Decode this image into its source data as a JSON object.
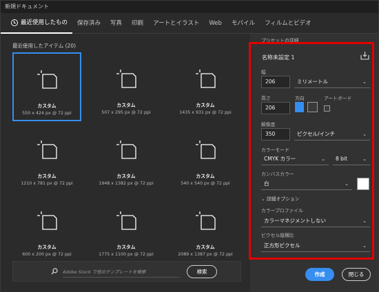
{
  "window": {
    "title": "新規ドキュメント"
  },
  "tabs": [
    {
      "label": "最近使用したもの"
    },
    {
      "label": "保存済み"
    },
    {
      "label": "写真"
    },
    {
      "label": "印刷"
    },
    {
      "label": "アートとイラスト"
    },
    {
      "label": "Web"
    },
    {
      "label": "モバイル"
    },
    {
      "label": "フィルムとビデオ"
    }
  ],
  "recent": {
    "title": "最近使用したアイテム (20)",
    "items": [
      {
        "name": "カスタム",
        "size": "550 x 424 px @ 72 ppi"
      },
      {
        "name": "カスタム",
        "size": "507 x 295 px @ 72 ppi"
      },
      {
        "name": "カスタム",
        "size": "1435 x 931 px @ 72 ppi"
      },
      {
        "name": "カスタム",
        "size": "1210 x 781 px @ 72 ppi"
      },
      {
        "name": "カスタム",
        "size": "1948 x 1382 px @ 72 ppi"
      },
      {
        "name": "カスタム",
        "size": "540 x 540 px @ 72 ppi"
      },
      {
        "name": "カスタム",
        "size": "600 x 200 px @ 72 ppi"
      },
      {
        "name": "カスタム",
        "size": "1775 x 1100 px @ 72 ppi"
      },
      {
        "name": "カスタム",
        "size": "2089 x 1387 px @ 72 ppi"
      }
    ]
  },
  "search": {
    "placeholder": "Adobe Stock で他のテンプレートを検索",
    "button": "検索"
  },
  "preset": {
    "header": "プリセットの詳細",
    "name": "名称未設定 1",
    "width_label": "幅",
    "width_value": "206",
    "width_unit": "ミリメートル",
    "height_label": "高さ",
    "height_value": "206",
    "orientation_label": "方向",
    "artboard_label": "アートボード",
    "resolution_label": "解像度",
    "resolution_value": "350",
    "resolution_unit": "ピクセル/インチ",
    "color_mode_label": "カラーモード",
    "color_mode_value": "CMYK カラー",
    "bit_depth": "8 bit",
    "canvas_color_label": "カンバスカラー",
    "canvas_color_value": "白",
    "canvas_swatch": "#ffffff",
    "advanced_label": "詳細オプション",
    "profile_label": "カラープロファイル",
    "profile_value": "カラーマネジメントしない",
    "pixel_aspect_label": "ピクセル縦横比",
    "pixel_aspect_value": "正方形ピクセル"
  },
  "buttons": {
    "create": "作成",
    "close": "閉じる"
  },
  "colors": {
    "accent": "#378ef0",
    "highlight": "#e50000"
  }
}
